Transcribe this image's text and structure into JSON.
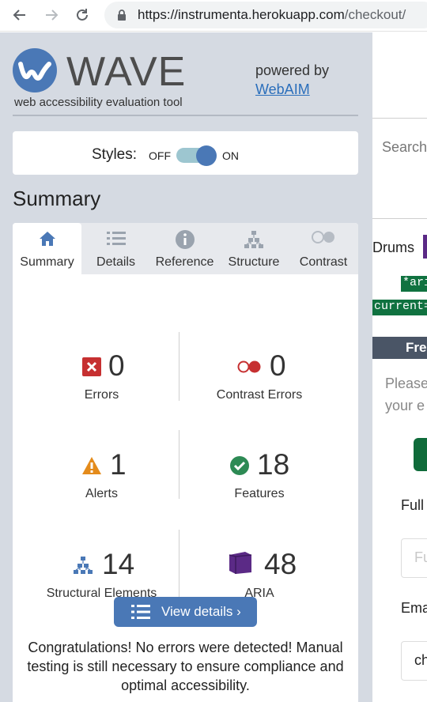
{
  "browser": {
    "url_host": "https://instrumenta.herokuapp.com",
    "url_path": "/checkout/"
  },
  "wave": {
    "logo_text": "WAVE",
    "tagline": "web accessibility evaluation tool",
    "powered_by": "powered by",
    "webaim_link": "WebAIM",
    "styles_label": "Styles:",
    "off_label": "OFF",
    "on_label": "ON",
    "styles_on": true,
    "summary_heading": "Summary",
    "tabs": [
      {
        "label": "Summary",
        "icon": "home-icon",
        "active": true
      },
      {
        "label": "Details",
        "icon": "list-icon",
        "active": false
      },
      {
        "label": "Reference",
        "icon": "info-icon",
        "active": false
      },
      {
        "label": "Structure",
        "icon": "hierarchy-icon",
        "active": false
      },
      {
        "label": "Contrast",
        "icon": "contrast-icon",
        "active": false
      }
    ],
    "stats": {
      "errors": {
        "count": "0",
        "label": "Errors"
      },
      "contrast_errors": {
        "count": "0",
        "label": "Contrast Errors"
      },
      "alerts": {
        "count": "1",
        "label": "Alerts"
      },
      "features": {
        "count": "18",
        "label": "Features"
      },
      "structural": {
        "count": "14",
        "label": "Structural Elements"
      },
      "aria": {
        "count": "48",
        "label": "ARIA"
      }
    },
    "view_details_label": "View details ›",
    "congrats": "Congratulations! No errors were detected! Manual testing is still necessary to ensure compliance and optimal accessibility."
  },
  "page": {
    "search": "Search",
    "drums": "Drums",
    "aria_tag": "*aria",
    "aria_current": "current=\"p",
    "bar_text": "Fre",
    "please_line1": "Please",
    "please_line2": "your e",
    "full_label": "Full",
    "full_placeholder": "Fu",
    "email_label": "Ema",
    "email_value": "ch"
  },
  "colors": {
    "wave_blue": "#4a78b6",
    "panel_bg": "#d5dae2",
    "error_red": "#c63031",
    "alert_orange": "#e48b1b",
    "feature_green": "#2d8a54",
    "aria_purple": "#5b2a86"
  }
}
